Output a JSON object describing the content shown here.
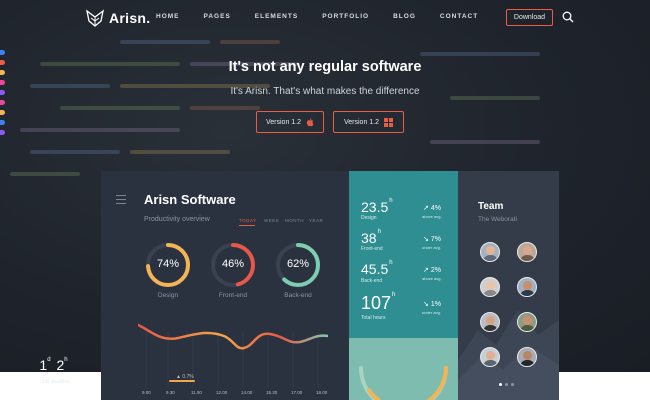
{
  "nav": {
    "logo_text": "Arisn.",
    "items": [
      "HOME",
      "PAGES",
      "ELEMENTS",
      "PORTFOLIO",
      "BLOG",
      "CONTACT"
    ],
    "download_label": "Download"
  },
  "hero": {
    "title": "It's not any regular software",
    "subtitle": "It's Arisn. That's what makes the difference",
    "buttons": [
      {
        "label": "Version 1.2",
        "icon": "apple-icon"
      },
      {
        "label": "Version 1.2",
        "icon": "windows-icon"
      }
    ]
  },
  "dashboard": {
    "title": "Arisn Software",
    "subtitle": "Productivity overview",
    "periods": [
      "TODAY",
      "WEEK",
      "MONTH",
      "YEAR"
    ],
    "active_period": "TODAY",
    "donuts": [
      {
        "value": "74%",
        "caption": "Design",
        "fraction": 0.74,
        "color": "#f3b456"
      },
      {
        "value": "46%",
        "caption": "Front-end",
        "fraction": 0.46,
        "color": "#e8584a"
      },
      {
        "value": "62%",
        "caption": "Back-end",
        "fraction": 0.62,
        "color": "#7dcdb1"
      }
    ],
    "chart_marker": "0.7%",
    "time_ticks": [
      "9.00",
      "9.30",
      "11.00",
      "12.00",
      "14.00",
      "15.30",
      "17.00",
      "18.00"
    ],
    "stats": [
      {
        "value": "23.5",
        "unit": "h",
        "label": "Design",
        "change": "4%",
        "direction": "up",
        "note": "above avg."
      },
      {
        "value": "38",
        "unit": "h",
        "label": "Front-end",
        "change": "7%",
        "direction": "down",
        "note": "under avg."
      },
      {
        "value": "45.5",
        "unit": "h",
        "label": "Back-end",
        "change": "2%",
        "direction": "up",
        "note": "above avg."
      },
      {
        "value": "107",
        "unit": "h",
        "label": "Total hours",
        "change": "1%",
        "direction": "down",
        "note": "under avg."
      }
    ],
    "deadline": {
      "days": "1",
      "days_unit": "d",
      "hours": "2",
      "hours_unit": "h",
      "label": "Until deadline"
    },
    "team": {
      "title": "Team",
      "subtitle": "The Weborati"
    }
  },
  "colors": {
    "accent": "#e85d43",
    "teal_panel": "#2f8e91",
    "dark_panel": "#2b323f"
  }
}
